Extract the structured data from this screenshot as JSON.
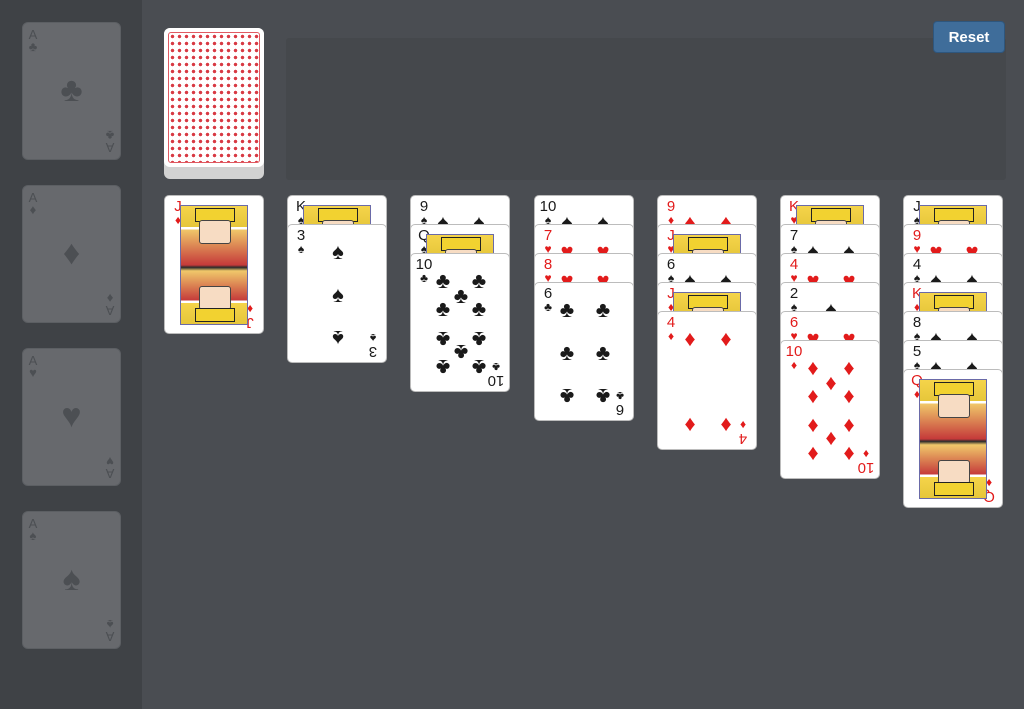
{
  "controls": {
    "reset_label": "Reset"
  },
  "foundations": [
    {
      "rank": "A",
      "suit": "♣",
      "suit_name": "clubs"
    },
    {
      "rank": "A",
      "suit": "♦",
      "suit_name": "diamonds"
    },
    {
      "rank": "A",
      "suit": "♥",
      "suit_name": "hearts"
    },
    {
      "rank": "A",
      "suit": "♠",
      "suit_name": "spades"
    }
  ],
  "stock": {
    "face_down": true,
    "back_color": "#d83a44"
  },
  "waste": {
    "cards": []
  },
  "tableau": [
    [
      {
        "rank": "J",
        "suit": "♦"
      }
    ],
    [
      {
        "rank": "K",
        "suit": "♠"
      },
      {
        "rank": "3",
        "suit": "♠"
      }
    ],
    [
      {
        "rank": "9",
        "suit": "♠"
      },
      {
        "rank": "Q",
        "suit": "♠"
      },
      {
        "rank": "10",
        "suit": "♣"
      }
    ],
    [
      {
        "rank": "10",
        "suit": "♠"
      },
      {
        "rank": "7",
        "suit": "♥"
      },
      {
        "rank": "8",
        "suit": "♥"
      },
      {
        "rank": "6",
        "suit": "♣"
      }
    ],
    [
      {
        "rank": "9",
        "suit": "♦"
      },
      {
        "rank": "J",
        "suit": "♥"
      },
      {
        "rank": "6",
        "suit": "♠"
      },
      {
        "rank": "J",
        "suit": "♦"
      },
      {
        "rank": "4",
        "suit": "♦"
      }
    ],
    [
      {
        "rank": "K",
        "suit": "♥"
      },
      {
        "rank": "7",
        "suit": "♠"
      },
      {
        "rank": "4",
        "suit": "♥"
      },
      {
        "rank": "2",
        "suit": "♠"
      },
      {
        "rank": "6",
        "suit": "♥"
      },
      {
        "rank": "10",
        "suit": "♦"
      }
    ],
    [
      {
        "rank": "J",
        "suit": "♠"
      },
      {
        "rank": "9",
        "suit": "♥"
      },
      {
        "rank": "4",
        "suit": "♠"
      },
      {
        "rank": "K",
        "suit": "♦"
      },
      {
        "rank": "8",
        "suit": "♠"
      },
      {
        "rank": "5",
        "suit": "♠"
      },
      {
        "rank": "Q",
        "suit": "♦"
      }
    ]
  ],
  "colors": {
    "table": "#4a4d52",
    "sidebar": "#3f4246",
    "red_suit": "#e21b1b",
    "black_suit": "#1a1a1a",
    "reset_button": "#3f6d9a"
  }
}
